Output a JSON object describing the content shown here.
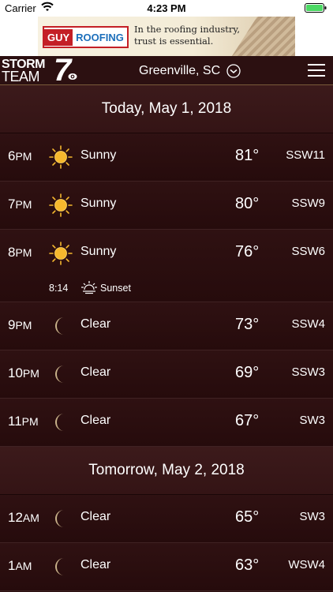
{
  "status_bar": {
    "carrier": "Carrier",
    "time": "4:23 PM"
  },
  "ad": {
    "logo_guy": "GUY",
    "logo_roofing": "ROOFING",
    "tagline": "In the roofing industry, trust is essential."
  },
  "header": {
    "logo_storm": "STORM",
    "logo_team": "TEAM",
    "logo_seven": "7",
    "location": "Greenville, SC"
  },
  "days": [
    {
      "label": "Today, May 1, 2018",
      "hours": [
        {
          "hour": "6",
          "ampm": "PM",
          "icon": "sun-icon",
          "condition": "Sunny",
          "temp": "81°",
          "wind": "SSW11"
        },
        {
          "hour": "7",
          "ampm": "PM",
          "icon": "sun-icon",
          "condition": "Sunny",
          "temp": "80°",
          "wind": "SSW9"
        },
        {
          "hour": "8",
          "ampm": "PM",
          "icon": "sun-icon",
          "condition": "Sunny",
          "temp": "76°",
          "wind": "SSW6",
          "event": {
            "time": "8:14",
            "icon": "sunset-icon",
            "label": "Sunset"
          }
        },
        {
          "hour": "9",
          "ampm": "PM",
          "icon": "moon-icon",
          "condition": "Clear",
          "temp": "73°",
          "wind": "SSW4"
        },
        {
          "hour": "10",
          "ampm": "PM",
          "icon": "moon-icon",
          "condition": "Clear",
          "temp": "69°",
          "wind": "SSW3"
        },
        {
          "hour": "11",
          "ampm": "PM",
          "icon": "moon-icon",
          "condition": "Clear",
          "temp": "67°",
          "wind": "SW3"
        }
      ]
    },
    {
      "label": "Tomorrow, May 2, 2018",
      "hours": [
        {
          "hour": "12",
          "ampm": "AM",
          "icon": "moon-icon",
          "condition": "Clear",
          "temp": "65°",
          "wind": "SW3"
        },
        {
          "hour": "1",
          "ampm": "AM",
          "icon": "moon-icon",
          "condition": "Clear",
          "temp": "63°",
          "wind": "WSW4"
        }
      ]
    }
  ],
  "colors": {
    "background": "#2a0f10",
    "sun": "#f5b82e",
    "moon": "#c9b28a",
    "accent_border": "#7a5b3a"
  }
}
